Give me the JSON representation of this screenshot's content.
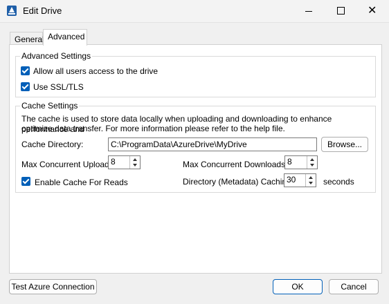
{
  "window": {
    "title": "Edit Drive",
    "minimize": "—",
    "maximize": "",
    "close": "✕"
  },
  "tabs": [
    {
      "label": "General"
    },
    {
      "label": "Advanced"
    }
  ],
  "advanced_settings": {
    "title": "Advanced Settings",
    "allow_all_users": {
      "label": "Allow all users access to the drive",
      "checked": true
    },
    "use_ssl": {
      "label": "Use SSL/TLS",
      "checked": true
    }
  },
  "cache_settings": {
    "title": "Cache Settings",
    "description_line1": "The cache is used to store data locally when uploading and downloading to enhance performance and",
    "description_line2": "optimize data transfer. For more information please refer to the help file.",
    "cache_directory_label": "Cache Directory:",
    "cache_directory_value": "C:\\ProgramData\\AzureDrive\\MyDrive",
    "browse_label": "Browse...",
    "max_uploads_label": "Max Concurrent Uploads:",
    "max_uploads_value": "8",
    "max_downloads_label": "Max Concurrent Downloads:",
    "max_downloads_value": "8",
    "enable_cache_reads": {
      "label": "Enable Cache For Reads",
      "checked": true
    },
    "metadata_caching_label": "Directory (Metadata) Caching:",
    "metadata_caching_value": "30",
    "metadata_caching_unit": "seconds"
  },
  "footer": {
    "test_label": "Test Azure Connection",
    "ok_label": "OK",
    "cancel_label": "Cancel"
  },
  "colors": {
    "checkbox": "#005fb8",
    "primary_border": "#005fb8"
  }
}
